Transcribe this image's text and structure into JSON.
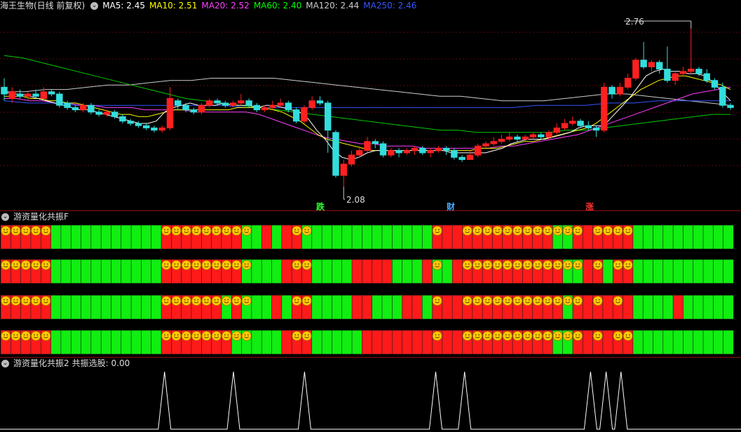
{
  "main": {
    "title": "海王生物(日线 前复权)",
    "indicators": [
      {
        "label": "MA5: 2.45",
        "color": "#ffffff"
      },
      {
        "label": "MA10: 2.51",
        "color": "#ffff00"
      },
      {
        "label": "MA20: 2.52",
        "color": "#ff40ff"
      },
      {
        "label": "MA60: 2.40",
        "color": "#00ff00"
      },
      {
        "label": "MA120: 2.44",
        "color": "#cccccc"
      },
      {
        "label": "MA250: 2.46",
        "color": "#3355ff"
      }
    ],
    "high_label": "2.76",
    "low_label": "2.08",
    "markers": [
      {
        "text": "跌",
        "color": "#33ff33"
      },
      {
        "text": "财",
        "color": "#44aaff"
      },
      {
        "text": "涨",
        "color": "#ff3333"
      }
    ],
    "candles_ohlc": [
      [
        2.52,
        2.49,
        2.56,
        2.46
      ],
      [
        2.47,
        2.5,
        2.52,
        2.45
      ],
      [
        2.49,
        2.48,
        2.51,
        2.47
      ],
      [
        2.48,
        2.49,
        2.5,
        2.46
      ],
      [
        2.49,
        2.48,
        2.51,
        2.47
      ],
      [
        2.47,
        2.5,
        2.52,
        2.46
      ],
      [
        2.5,
        2.49,
        2.51,
        2.48
      ],
      [
        2.49,
        2.44,
        2.5,
        2.43
      ],
      [
        2.45,
        2.43,
        2.46,
        2.42
      ],
      [
        2.43,
        2.42,
        2.44,
        2.41
      ],
      [
        2.42,
        2.44,
        2.45,
        2.41
      ],
      [
        2.44,
        2.41,
        2.45,
        2.4
      ],
      [
        2.41,
        2.4,
        2.42,
        2.39
      ],
      [
        2.4,
        2.41,
        2.42,
        2.39
      ],
      [
        2.41,
        2.39,
        2.42,
        2.38
      ],
      [
        2.39,
        2.37,
        2.4,
        2.36
      ],
      [
        2.37,
        2.36,
        2.38,
        2.35
      ],
      [
        2.36,
        2.35,
        2.37,
        2.34
      ],
      [
        2.35,
        2.34,
        2.36,
        2.33
      ],
      [
        2.34,
        2.33,
        2.35,
        2.32
      ],
      [
        2.33,
        2.34,
        2.35,
        2.32
      ],
      [
        2.34,
        2.47,
        2.52,
        2.33
      ],
      [
        2.46,
        2.44,
        2.47,
        2.42
      ],
      [
        2.44,
        2.42,
        2.45,
        2.41
      ],
      [
        2.42,
        2.41,
        2.43,
        2.4
      ],
      [
        2.41,
        2.44,
        2.45,
        2.4
      ],
      [
        2.44,
        2.46,
        2.47,
        2.43
      ],
      [
        2.46,
        2.45,
        2.47,
        2.44
      ],
      [
        2.45,
        2.44,
        2.46,
        2.43
      ],
      [
        2.44,
        2.45,
        2.46,
        2.43
      ],
      [
        2.45,
        2.46,
        2.49,
        2.44
      ],
      [
        2.46,
        2.44,
        2.47,
        2.43
      ],
      [
        2.44,
        2.42,
        2.45,
        2.41
      ],
      [
        2.42,
        2.43,
        2.44,
        2.41
      ],
      [
        2.43,
        2.44,
        2.46,
        2.42
      ],
      [
        2.44,
        2.45,
        2.47,
        2.43
      ],
      [
        2.45,
        2.42,
        2.46,
        2.41
      ],
      [
        2.42,
        2.37,
        2.43,
        2.36
      ],
      [
        2.37,
        2.43,
        2.44,
        2.36
      ],
      [
        2.43,
        2.46,
        2.48,
        2.42
      ],
      [
        2.46,
        2.45,
        2.48,
        2.44
      ],
      [
        2.45,
        2.33,
        2.46,
        2.23
      ],
      [
        2.32,
        2.13,
        2.33,
        2.12
      ],
      [
        2.13,
        2.18,
        2.2,
        2.08
      ],
      [
        2.18,
        2.22,
        2.24,
        2.17
      ],
      [
        2.22,
        2.24,
        2.26,
        2.21
      ],
      [
        2.24,
        2.28,
        2.3,
        2.23
      ],
      [
        2.28,
        2.27,
        2.29,
        2.25
      ],
      [
        2.27,
        2.22,
        2.28,
        2.21
      ],
      [
        2.22,
        2.24,
        2.25,
        2.21
      ],
      [
        2.24,
        2.23,
        2.25,
        2.21
      ],
      [
        2.23,
        2.24,
        2.25,
        2.22
      ],
      [
        2.24,
        2.25,
        2.26,
        2.22
      ],
      [
        2.25,
        2.23,
        2.26,
        2.22
      ],
      [
        2.23,
        2.24,
        2.25,
        2.21
      ],
      [
        2.24,
        2.25,
        2.26,
        2.23
      ],
      [
        2.25,
        2.24,
        2.26,
        2.22
      ],
      [
        2.24,
        2.21,
        2.25,
        2.2
      ],
      [
        2.21,
        2.2,
        2.22,
        2.19
      ],
      [
        2.2,
        2.22,
        2.24,
        2.2
      ],
      [
        2.22,
        2.26,
        2.27,
        2.21
      ],
      [
        2.26,
        2.27,
        2.28,
        2.25
      ],
      [
        2.27,
        2.28,
        2.3,
        2.26
      ],
      [
        2.28,
        2.29,
        2.31,
        2.27
      ],
      [
        2.29,
        2.3,
        2.32,
        2.28
      ],
      [
        2.3,
        2.29,
        2.31,
        2.28
      ],
      [
        2.29,
        2.3,
        2.31,
        2.28
      ],
      [
        2.3,
        2.31,
        2.32,
        2.29
      ],
      [
        2.31,
        2.3,
        2.32,
        2.29
      ],
      [
        2.3,
        2.32,
        2.33,
        2.29
      ],
      [
        2.32,
        2.34,
        2.36,
        2.31
      ],
      [
        2.34,
        2.36,
        2.38,
        2.33
      ],
      [
        2.36,
        2.37,
        2.39,
        2.35
      ],
      [
        2.37,
        2.35,
        2.38,
        2.34
      ],
      [
        2.35,
        2.34,
        2.37,
        2.33
      ],
      [
        2.34,
        2.33,
        2.35,
        2.3
      ],
      [
        2.33,
        2.52,
        2.54,
        2.32
      ],
      [
        2.52,
        2.49,
        2.53,
        2.47
      ],
      [
        2.49,
        2.52,
        2.54,
        2.48
      ],
      [
        2.52,
        2.56,
        2.58,
        2.51
      ],
      [
        2.56,
        2.64,
        2.65,
        2.55
      ],
      [
        2.64,
        2.61,
        2.72,
        2.6
      ],
      [
        2.61,
        2.63,
        2.64,
        2.59
      ],
      [
        2.63,
        2.6,
        2.64,
        2.58
      ],
      [
        2.6,
        2.55,
        2.7,
        2.54
      ],
      [
        2.55,
        2.58,
        2.59,
        2.53
      ],
      [
        2.58,
        2.59,
        2.61,
        2.57
      ],
      [
        2.59,
        2.6,
        2.78,
        2.58
      ],
      [
        2.6,
        2.58,
        2.61,
        2.57
      ],
      [
        2.58,
        2.55,
        2.6,
        2.54
      ],
      [
        2.55,
        2.52,
        2.56,
        2.51
      ],
      [
        2.52,
        2.44,
        2.54,
        2.43
      ],
      [
        2.44,
        2.43,
        2.45,
        2.42
      ]
    ],
    "ma5": [
      2.5,
      2.49,
      2.49,
      2.48,
      2.47,
      2.46,
      2.45,
      2.44,
      2.43,
      2.42,
      2.42,
      2.41,
      2.4,
      2.39,
      2.38,
      2.37,
      2.36,
      2.36,
      2.37,
      2.41,
      2.43,
      2.44,
      2.45,
      2.44,
      2.44,
      2.44,
      2.45,
      2.44,
      2.44,
      2.44,
      2.43,
      2.44,
      2.44,
      2.43,
      2.42,
      2.41,
      2.38,
      2.33,
      2.29,
      2.24,
      2.21,
      2.2,
      2.21,
      2.23,
      2.24,
      2.24,
      2.24,
      2.24,
      2.24,
      2.24,
      2.24,
      2.24,
      2.24,
      2.23,
      2.23,
      2.23,
      2.23,
      2.23,
      2.24,
      2.25,
      2.27,
      2.28,
      2.29,
      2.29,
      2.29,
      2.3,
      2.31,
      2.32,
      2.34,
      2.35,
      2.35,
      2.35,
      2.39,
      2.43,
      2.47,
      2.52,
      2.57,
      2.59,
      2.6,
      2.59,
      2.59,
      2.58,
      2.58,
      2.57,
      2.54,
      2.5,
      2.46
    ],
    "ma10": [
      2.48,
      2.48,
      2.48,
      2.47,
      2.47,
      2.46,
      2.46,
      2.45,
      2.45,
      2.44,
      2.43,
      2.42,
      2.41,
      2.4,
      2.4,
      2.39,
      2.39,
      2.4,
      2.41,
      2.42,
      2.42,
      2.42,
      2.42,
      2.42,
      2.42,
      2.42,
      2.43,
      2.43,
      2.43,
      2.43,
      2.42,
      2.41,
      2.39,
      2.37,
      2.34,
      2.31,
      2.29,
      2.28,
      2.27,
      2.26,
      2.25,
      2.24,
      2.24,
      2.24,
      2.24,
      2.24,
      2.24,
      2.24,
      2.24,
      2.24,
      2.24,
      2.24,
      2.24,
      2.25,
      2.25,
      2.25,
      2.26,
      2.27,
      2.28,
      2.28,
      2.29,
      2.3,
      2.31,
      2.32,
      2.33,
      2.34,
      2.36,
      2.39,
      2.42,
      2.45,
      2.48,
      2.51,
      2.53,
      2.55,
      2.56,
      2.57,
      2.57,
      2.56,
      2.55,
      2.54,
      2.53,
      2.51
    ],
    "ma20": [
      2.47,
      2.47,
      2.46,
      2.46,
      2.45,
      2.45,
      2.44,
      2.44,
      2.43,
      2.43,
      2.43,
      2.42,
      2.42,
      2.42,
      2.42,
      2.41,
      2.41,
      2.41,
      2.41,
      2.41,
      2.4,
      2.38,
      2.36,
      2.34,
      2.32,
      2.3,
      2.29,
      2.28,
      2.27,
      2.27,
      2.26,
      2.26,
      2.26,
      2.25,
      2.25,
      2.25,
      2.25,
      2.25,
      2.25,
      2.26,
      2.26,
      2.27,
      2.28,
      2.29,
      2.3,
      2.31,
      2.33,
      2.35,
      2.37,
      2.39,
      2.41,
      2.43,
      2.45,
      2.47,
      2.49,
      2.5,
      2.51,
      2.52
    ],
    "ma60": [
      2.66,
      2.65,
      2.63,
      2.61,
      2.59,
      2.57,
      2.55,
      2.53,
      2.51,
      2.49,
      2.47,
      2.46,
      2.45,
      2.44,
      2.43,
      2.42,
      2.41,
      2.4,
      2.39,
      2.38,
      2.37,
      2.36,
      2.35,
      2.34,
      2.33,
      2.33,
      2.32,
      2.32,
      2.32,
      2.32,
      2.32,
      2.33,
      2.33,
      2.34,
      2.35,
      2.36,
      2.37,
      2.38,
      2.39,
      2.4,
      2.4
    ],
    "ma120": [
      2.5,
      2.5,
      2.51,
      2.51,
      2.52,
      2.53,
      2.53,
      2.54,
      2.55,
      2.55,
      2.56,
      2.56,
      2.56,
      2.56,
      2.55,
      2.54,
      2.53,
      2.52,
      2.51,
      2.5,
      2.49,
      2.48,
      2.48,
      2.47,
      2.46,
      2.46,
      2.46,
      2.47,
      2.48,
      2.49,
      2.49,
      2.48,
      2.47,
      2.46,
      2.45,
      2.44
    ],
    "ma250": [
      2.46,
      2.45,
      2.45,
      2.44,
      2.44,
      2.44,
      2.44,
      2.44,
      2.44,
      2.44,
      2.43,
      2.43,
      2.43,
      2.43,
      2.43,
      2.43,
      2.43,
      2.43,
      2.43,
      2.43,
      2.43,
      2.43,
      2.44,
      2.44,
      2.44,
      2.45,
      2.45,
      2.46,
      2.46,
      2.46,
      2.46
    ]
  },
  "resonance": {
    "title": "游资量化共振F",
    "rows_state": [
      "RRRRRGGGGGGGGGGGRRRRRRRRGGRGRRGGGGGGGGGGGGGRRRRRRRRRRRRGGRRRRRRGGGGGGGGGG",
      "RRRRRGGGGGGGGGGGRRRRRRRRGGGGRRRGGGGRRRRGGGRGGRRRRRRRRRRRGGRRGRRGGGGGGGGGG",
      "RRRRRGGGGGGGGGGGRRRRRRGRGGGRGRRGGGGRRGGGRRGRRRRRRRRRRRRRGRRRRRRGGGGRGGGGG",
      "RRRRRGGGGGGGGGGGRRRRRRRGGGGGRRRGGGGGRRRRRRRRRRRRRRRRRRRGGRRRRRRGGGGGGGGGG"
    ],
    "smiley_cells": [
      [
        0,
        1,
        2,
        3,
        4,
        16,
        17,
        18,
        19,
        20,
        21,
        22,
        23,
        24,
        29,
        30,
        43,
        46,
        47,
        48,
        49,
        50,
        51,
        52,
        53,
        54,
        55,
        56,
        57,
        59,
        60,
        61,
        62
      ],
      [
        0,
        1,
        2,
        3,
        4,
        16,
        17,
        18,
        19,
        20,
        21,
        22,
        23,
        24,
        29,
        30,
        43,
        46,
        47,
        48,
        49,
        50,
        51,
        52,
        53,
        54,
        55,
        56,
        57,
        59,
        61,
        62
      ],
      [
        0,
        1,
        2,
        3,
        4,
        16,
        17,
        18,
        19,
        20,
        21,
        22,
        23,
        24,
        29,
        30,
        43,
        46,
        47,
        48,
        49,
        50,
        51,
        52,
        53,
        54,
        55,
        56,
        57,
        59,
        61
      ],
      [
        0,
        1,
        2,
        3,
        4,
        16,
        17,
        18,
        19,
        20,
        21,
        22,
        23,
        24,
        29,
        30,
        43,
        46,
        47,
        48,
        49,
        50,
        51,
        52,
        53,
        54,
        55,
        56,
        57,
        59,
        61,
        62
      ]
    ],
    "colors": {
      "red": "#ff1a1a",
      "green": "#11ee11",
      "smiley": "#ffcc00"
    }
  },
  "select": {
    "title": "游资量化共振2",
    "value_label": "共振选股: 0.00",
    "spike_positions": [
      0.222,
      0.315,
      0.411,
      0.588,
      0.627,
      0.797,
      0.818,
      0.838
    ]
  }
}
